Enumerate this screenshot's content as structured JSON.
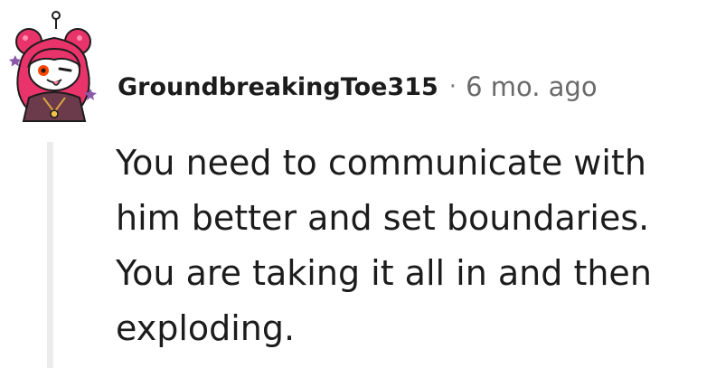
{
  "comment": {
    "avatar_icon": "snoo-avatar-icon",
    "author": "GroundbreakingToe315",
    "separator": "·",
    "timestamp": "6 mo. ago",
    "body": "You need to communicate with him better and set boundaries. You are taking it all in and then exploding."
  },
  "colors": {
    "text": "#1c1c1c",
    "meta": "#6a6a6a",
    "thread_line": "#ececec",
    "avatar_hair": "#e8336b",
    "avatar_robe": "#6b3a4b"
  }
}
